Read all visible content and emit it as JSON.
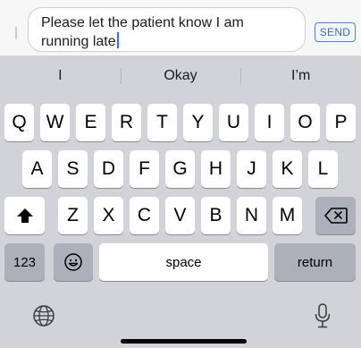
{
  "compose": {
    "message_text": "Please let the patient know I am running late",
    "send_label": "SEND"
  },
  "suggestions": [
    "I",
    "Okay",
    "I’m"
  ],
  "keyboard": {
    "row1": [
      "Q",
      "W",
      "E",
      "R",
      "T",
      "Y",
      "U",
      "I",
      "O",
      "P"
    ],
    "row2": [
      "A",
      "S",
      "D",
      "F",
      "G",
      "H",
      "J",
      "K",
      "L"
    ],
    "row3": [
      "Z",
      "X",
      "C",
      "V",
      "B",
      "N",
      "M"
    ],
    "numbers_label": "123",
    "space_label": "space",
    "return_label": "return"
  },
  "icons": {
    "shift": "shift-arrow-icon",
    "delete": "backspace-icon",
    "emoji": "emoji-face-icon",
    "globe": "globe-icon",
    "dictation": "microphone-icon"
  },
  "colors": {
    "caret": "#2f6df6",
    "send": "#2f6fd1",
    "keyboard_bg": "#d1d3d8",
    "special_key": "#abb0ba"
  }
}
